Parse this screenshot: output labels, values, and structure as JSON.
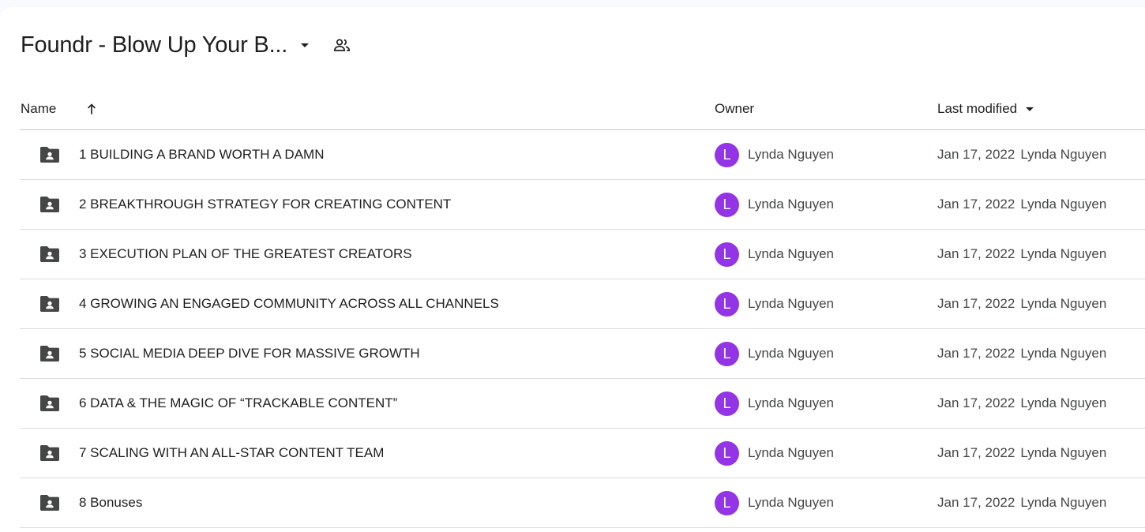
{
  "folder": {
    "title": "Foundr - Blow Up Your B...",
    "caret_icon": "arrow-drop-down-icon",
    "shared_icon": "people-icon"
  },
  "columns": {
    "name": "Name",
    "owner": "Owner",
    "last_modified": "Last modified",
    "sort_icon": "arrow-upward-icon",
    "modified_caret_icon": "arrow-drop-down-icon"
  },
  "rows": [
    {
      "name": "1 BUILDING A BRAND WORTH A DAMN",
      "owner": "Lynda Nguyen",
      "avatar": "L",
      "date": "Jan 17, 2022",
      "modified_by": "Lynda Nguyen",
      "icon": "shared-folder-icon"
    },
    {
      "name": "2 BREAKTHROUGH STRATEGY FOR CREATING CONTENT",
      "owner": "Lynda Nguyen",
      "avatar": "L",
      "date": "Jan 17, 2022",
      "modified_by": "Lynda Nguyen",
      "icon": "shared-folder-icon"
    },
    {
      "name": "3 EXECUTION PLAN OF THE GREATEST CREATORS",
      "owner": "Lynda Nguyen",
      "avatar": "L",
      "date": "Jan 17, 2022",
      "modified_by": "Lynda Nguyen",
      "icon": "shared-folder-icon"
    },
    {
      "name": "4 GROWING AN ENGAGED COMMUNITY ACROSS ALL CHANNELS",
      "owner": "Lynda Nguyen",
      "avatar": "L",
      "date": "Jan 17, 2022",
      "modified_by": "Lynda Nguyen",
      "icon": "shared-folder-icon"
    },
    {
      "name": "5 SOCIAL MEDIA DEEP DIVE FOR MASSIVE GROWTH",
      "owner": "Lynda Nguyen",
      "avatar": "L",
      "date": "Jan 17, 2022",
      "modified_by": "Lynda Nguyen",
      "icon": "shared-folder-icon"
    },
    {
      "name": "6 DATA & THE MAGIC OF “TRACKABLE CONTENT”",
      "owner": "Lynda Nguyen",
      "avatar": "L",
      "date": "Jan 17, 2022",
      "modified_by": "Lynda Nguyen",
      "icon": "shared-folder-icon"
    },
    {
      "name": "7 SCALING WITH AN ALL-STAR CONTENT TEAM",
      "owner": "Lynda Nguyen",
      "avatar": "L",
      "date": "Jan 17, 2022",
      "modified_by": "Lynda Nguyen",
      "icon": "shared-folder-icon"
    },
    {
      "name": "8 Bonuses",
      "owner": "Lynda Nguyen",
      "avatar": "L",
      "date": "Jan 17, 2022",
      "modified_by": "Lynda Nguyen",
      "icon": "shared-folder-icon"
    }
  ],
  "colors": {
    "avatar_bg": "#9334e6",
    "icon_gray": "#444746",
    "text": "#1f1f1f"
  }
}
